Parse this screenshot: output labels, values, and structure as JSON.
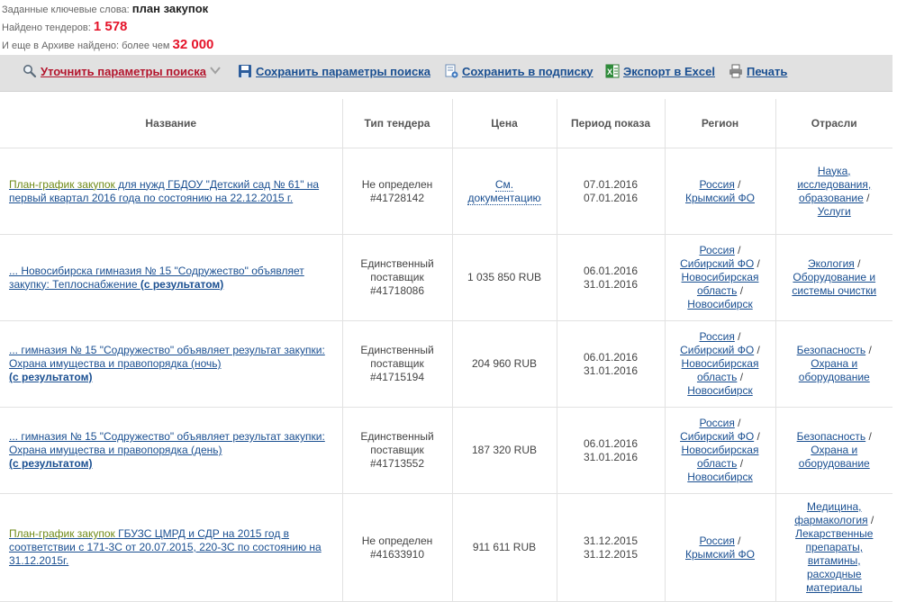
{
  "summary": {
    "keywords_label": "Заданные ключевые слова:",
    "keywords_value": "план закупок",
    "found_label": "Найдено тендеров:",
    "found_value": "1 578",
    "archive_label": "И еще в Архиве найдено: более чем",
    "archive_value": "32 000"
  },
  "toolbar": {
    "refine": "Уточнить параметры поиска",
    "save_params": "Сохранить параметры поиска",
    "save_subscription": "Сохранить в подписку",
    "export_excel": "Экспорт в Excel",
    "print": "Печать"
  },
  "table": {
    "headers": [
      "Название",
      "Тип тендера",
      "Цена",
      "Период показа",
      "Регион",
      "Отрасли"
    ],
    "rows": [
      {
        "title_lead": "План-график закупок",
        "title_rest": " для нужд ГБДОУ \"Детский сад № 61\" на первый квартал 2016 года по состоянию на 22.12.2015 г.",
        "title_result": "",
        "type_lines": [
          "Не определен",
          "#41728142"
        ],
        "price": "См. документацию",
        "period": [
          "07.01.2016",
          "07.01.2016"
        ],
        "regions": [
          "Россия",
          "Крымский ФО"
        ],
        "industries": [
          "Наука, исследования, образование",
          "Услуги"
        ]
      },
      {
        "title_lead": "",
        "title_rest": "... Новосибирска гимназия № 15 \"Содружество\" объявляет закупку: Теплоснабжение",
        "title_result": "(с результатом)",
        "type_lines": [
          "Единственный поставщик",
          "#41718086"
        ],
        "price": "1 035 850 RUB",
        "period": [
          "06.01.2016",
          "31.01.2016"
        ],
        "regions": [
          "Россия",
          "Сибирский ФО",
          "Новосибирская область",
          "Новосибирск"
        ],
        "industries": [
          "Экология",
          "Оборудование и системы очистки"
        ]
      },
      {
        "title_lead": "",
        "title_rest": "... гимназия № 15 \"Содружество\" объявляет результат закупки: Охрана имущества и правопорядка (ночь)",
        "title_result": "(с результатом)",
        "type_lines": [
          "Единственный поставщик",
          "#41715194"
        ],
        "price": "204 960 RUB",
        "period": [
          "06.01.2016",
          "31.01.2016"
        ],
        "regions": [
          "Россия",
          "Сибирский ФО",
          "Новосибирская область",
          "Новосибирск"
        ],
        "industries": [
          "Безопасность",
          "Охрана и оборудование"
        ]
      },
      {
        "title_lead": "",
        "title_rest": "... гимназия № 15 \"Содружество\" объявляет результат закупки: Охрана имущества и правопорядка (день)",
        "title_result": "(с результатом)",
        "type_lines": [
          "Единственный поставщик",
          "#41713552"
        ],
        "price": "187 320 RUB",
        "period": [
          "06.01.2016",
          "31.01.2016"
        ],
        "regions": [
          "Россия",
          "Сибирский ФО",
          "Новосибирская область",
          "Новосибирск"
        ],
        "industries": [
          "Безопасность",
          "Охрана и оборудование"
        ]
      },
      {
        "title_lead": "План-график закупок",
        "title_rest": " ГБУЗС ЦМРД и СДР на 2015 год в соответствии с 171-3С от 20.07.2015, 220-3С по состоянию на 31.12.2015г.",
        "title_result": "",
        "type_lines": [
          "Не определен",
          "#41633910"
        ],
        "price": "911 611 RUB",
        "period": [
          "31.12.2015",
          "31.12.2015"
        ],
        "regions": [
          "Россия",
          "Крымский ФО"
        ],
        "industries": [
          "Медицина, фармакология",
          "Лекарственные препараты, витамины, расходные материалы"
        ]
      }
    ]
  },
  "colors": {
    "link": "#1a4f91",
    "accent_red": "#e5142a",
    "highlight_green": "#6e8a17",
    "toolbar_bg": "#e1e1e1"
  },
  "icons": [
    "search-icon",
    "chevron-down-icon",
    "save-disk-icon",
    "subscription-icon",
    "excel-icon",
    "printer-icon"
  ]
}
